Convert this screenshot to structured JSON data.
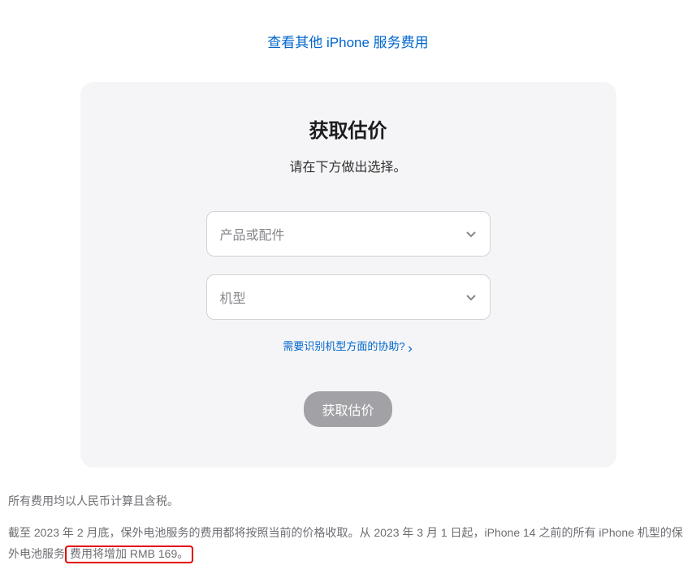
{
  "topLink": {
    "label": "查看其他 iPhone 服务费用"
  },
  "card": {
    "title": "获取估价",
    "subtitle": "请在下方做出选择。",
    "select1": {
      "placeholder": "产品或配件"
    },
    "select2": {
      "placeholder": "机型"
    },
    "helpLink": {
      "label": "需要识别机型方面的协助?"
    },
    "submitButton": {
      "label": "获取估价"
    }
  },
  "footer": {
    "p1": "所有费用均以人民币计算且含税。",
    "p2_part1": "截至 2023 年 2 月底，保外电池服务的费用都将按照当前的价格收取。从 2023 年 3 月 1 日起，iPhone 14 之前的所有 iPhone 机型的保外电池服务",
    "p2_highlight": "费用将增加 RMB 169。"
  }
}
